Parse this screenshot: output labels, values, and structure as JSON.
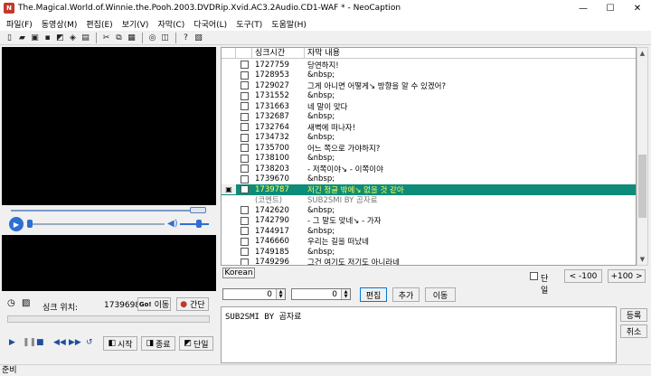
{
  "window": {
    "title": "The.Magical.World.of.Winnie.the.Pooh.2003.DVDRip.Xvid.AC3.2Audio.CD1-WAF * - NeoCaption",
    "minimize": "—",
    "maximize": "☐",
    "close": "✕"
  },
  "menu": [
    "파일(F)",
    "동영상(M)",
    "편집(E)",
    "보기(V)",
    "자막(C)",
    "다국어(L)",
    "도구(T)",
    "도움말(H)"
  ],
  "grid": {
    "col_time": "싱크시간",
    "col_text": "자막 내용",
    "rows": [
      {
        "time": "1727759",
        "text": "당연하지!",
        "kind": "normal"
      },
      {
        "time": "1728953",
        "text": "&nbsp;",
        "kind": "normal"
      },
      {
        "time": "1729027",
        "text": "그게 아니면 어떻게↘ 방향을 알 수 있겠어?",
        "kind": "normal"
      },
      {
        "time": "1731552",
        "text": "&nbsp;",
        "kind": "normal"
      },
      {
        "time": "1731663",
        "text": "네 말이 맞다",
        "kind": "normal"
      },
      {
        "time": "1732687",
        "text": "&nbsp;",
        "kind": "normal"
      },
      {
        "time": "1732764",
        "text": "새벽에 떠나자!",
        "kind": "normal"
      },
      {
        "time": "1734732",
        "text": "&nbsp;",
        "kind": "normal"
      },
      {
        "time": "1735700",
        "text": "어느 쪽으로 가야하지?",
        "kind": "normal"
      },
      {
        "time": "1738100",
        "text": "&nbsp;",
        "kind": "normal"
      },
      {
        "time": "1738203",
        "text": "- 저쪽이야↘ - 이쪽이야",
        "kind": "normal"
      },
      {
        "time": "1739670",
        "text": "&nbsp;",
        "kind": "normal"
      },
      {
        "time": "1739787",
        "text": "저긴 정글 밖에↘ 없을 것 같아",
        "kind": "selected"
      },
      {
        "time": "(코멘트)",
        "text": "SUB2SMI BY 곰자료",
        "kind": "comment"
      },
      {
        "time": "1742620",
        "text": "&nbsp;",
        "kind": "normal"
      },
      {
        "time": "1742790",
        "text": "- 그 말도 맞네↘ - 가자",
        "kind": "normal"
      },
      {
        "time": "1744917",
        "text": "&nbsp;",
        "kind": "normal"
      },
      {
        "time": "1746660",
        "text": "우리는 길을 떠났네",
        "kind": "normal"
      },
      {
        "time": "1749185",
        "text": "&nbsp;",
        "kind": "normal"
      },
      {
        "time": "1749296",
        "text": "그건 여기도 저기도 아니라네",
        "kind": "normal"
      }
    ]
  },
  "sync": {
    "label": "싱크 위치:",
    "value": "1739698",
    "move_btn": "이동",
    "move_prefix": "Go!",
    "interval_btn": "간단"
  },
  "controls": {
    "start_btn": "시작",
    "end_btn": "종료",
    "single_btn": "단일"
  },
  "tabs": {
    "korean": "Korean"
  },
  "options": {
    "single_label": "단일",
    "minus_btn": "< -100",
    "plus_btn": "+100 >"
  },
  "edit": {
    "spin1": "0",
    "spin2": "0",
    "edit_btn": "편집",
    "add_btn": "추가",
    "move_btn": "이동",
    "register_btn": "등록",
    "cancel_btn": "취소",
    "text": "SUB2SMI BY 곰자료"
  },
  "status": {
    "text": "준비"
  },
  "colors": {
    "selected_bg": "#0e8c7a",
    "selected_fg": "#ffff55",
    "accent": "#2d6fd3"
  }
}
